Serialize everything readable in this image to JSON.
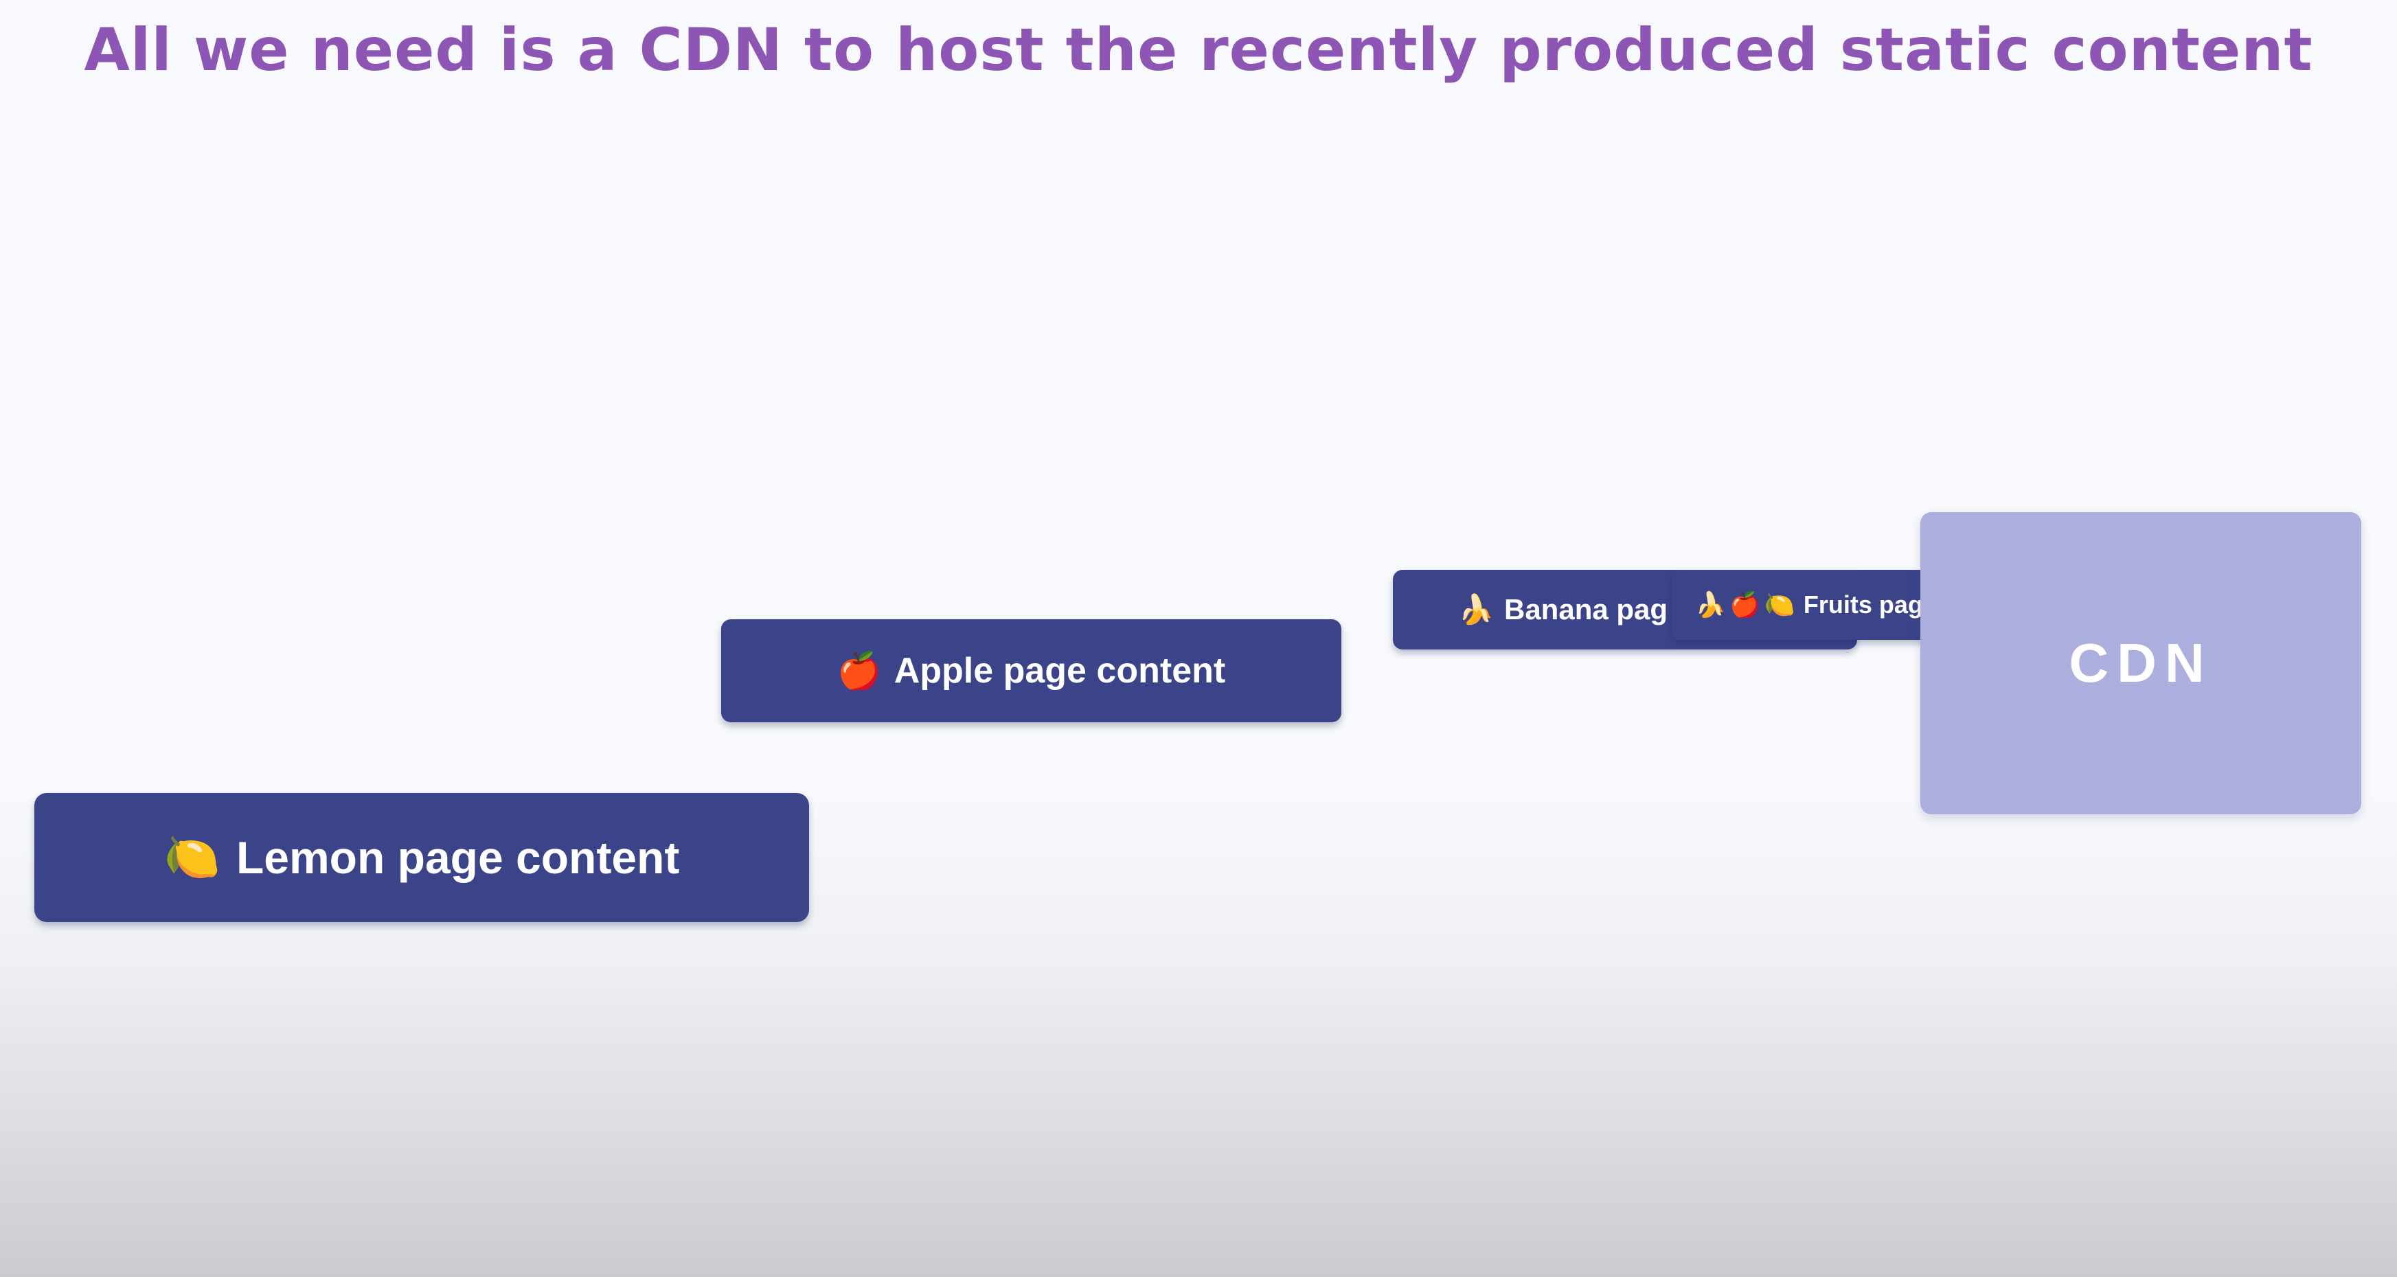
{
  "title": "All we need is a CDN to host the recently produced static content",
  "cards": {
    "lemon": {
      "emoji": "🍋",
      "label": "Lemon page content"
    },
    "apple": {
      "emoji": "🍎",
      "label": "Apple page content"
    },
    "banana": {
      "emoji": "🍌",
      "label": "Banana pag"
    },
    "fruits": {
      "emoji_banana": "🍌",
      "emoji_apple": "🍎",
      "emoji_lemon": "🍋",
      "label": "Fruits pag"
    }
  },
  "cdn": {
    "label": "CDN"
  },
  "colors": {
    "title": "#8e56b4",
    "card_bg": "#3b4489",
    "cdn_bg": "#acaede",
    "background": "#f7f9fd"
  }
}
